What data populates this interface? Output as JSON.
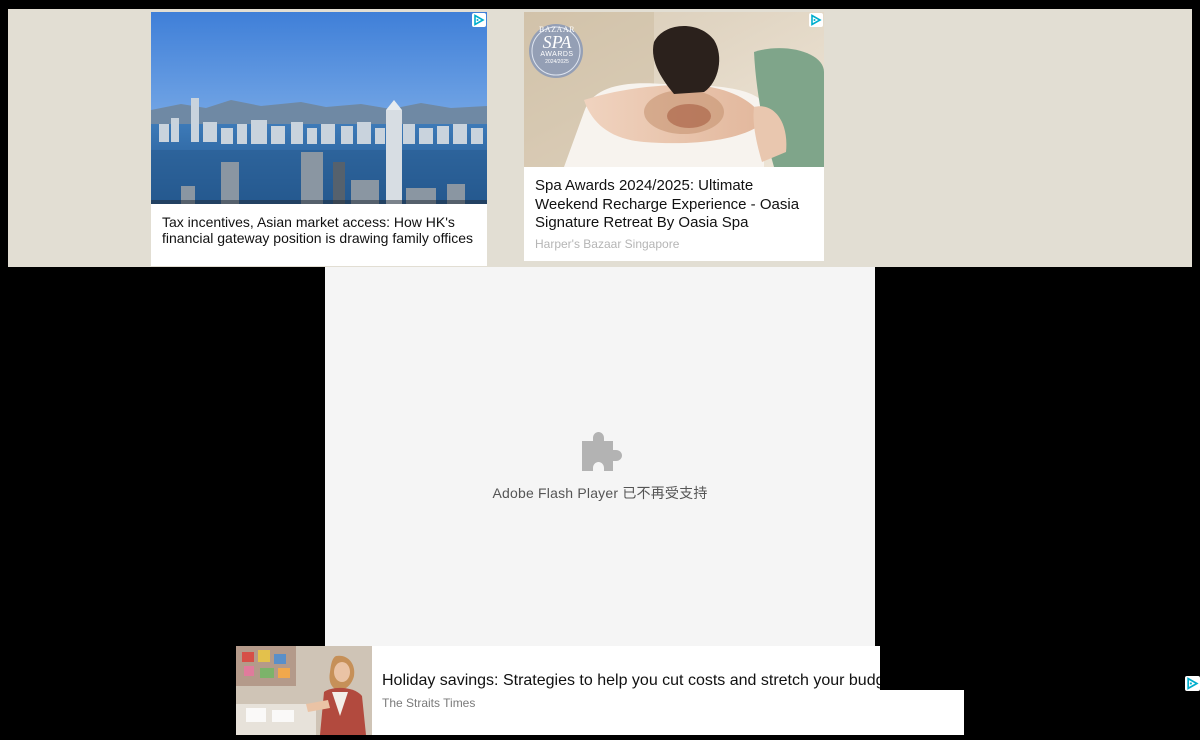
{
  "ads": {
    "card1": {
      "title": "Tax incentives, Asian market access: How HK's financial gateway position is drawing family offices",
      "image": "hong-kong-skyline-photo",
      "adchoices_icon": "adchoices-icon"
    },
    "card2": {
      "title": "Spa Awards 2024/2025: Ultimate Weekend Recharge Experience - Oasia Signature Retreat By Oasia Spa",
      "source": "Harper's Bazaar Singapore",
      "image": "spa-massage-photo",
      "badge": {
        "line1": "BAZAAR",
        "line2": "SPA",
        "line3": "AWARDS",
        "line4": "2024/2025"
      },
      "adchoices_icon": "adchoices-icon"
    },
    "bottom": {
      "title": "Holiday savings: Strategies to help you cut costs and stretch your budget",
      "source": "The Straits Times",
      "image": "market-shopping-photo"
    },
    "corner_adchoices_icon": "adchoices-icon"
  },
  "flash_plugin": {
    "icon": "puzzle-piece-icon",
    "message": "Adobe Flash Player 已不再受支持"
  },
  "colors": {
    "page_background": "#000000",
    "ad_band_background": "#e2ded3",
    "plugin_background": "#f5f5f5",
    "plugin_icon": "#b3b3b3",
    "adchoices_accent": "#00aecd"
  }
}
